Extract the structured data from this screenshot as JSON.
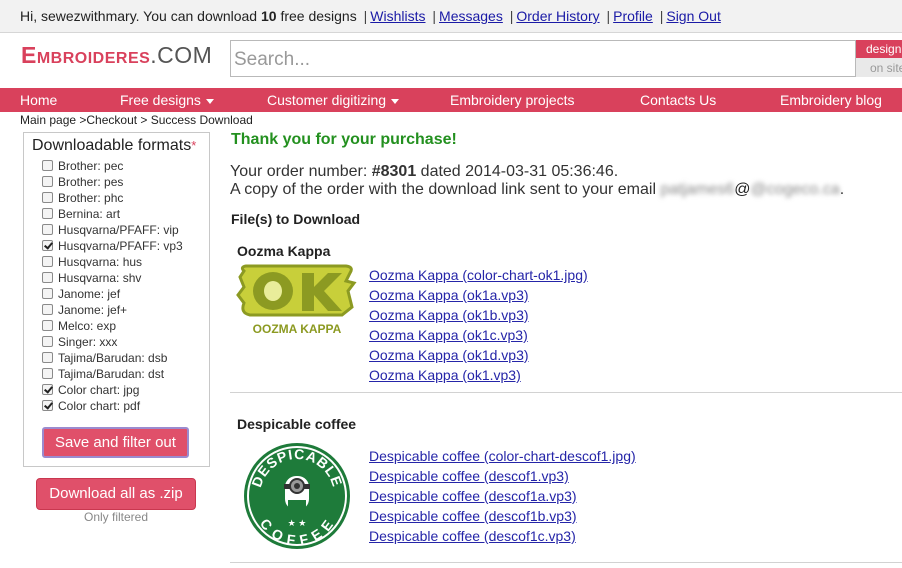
{
  "topbar": {
    "greeting_prefix": "Hi, sewezwithmary. You can download ",
    "free_count": "10",
    "greeting_suffix": " free designs",
    "links": [
      "Wishlists",
      "Messages",
      "Order History",
      "Profile",
      "Sign Out"
    ]
  },
  "header": {
    "logo_main": "Embroideres",
    "logo_suffix": ".COM",
    "search_placeholder": "Search...",
    "search_scope_designs": "design",
    "search_scope_site": "on site"
  },
  "nav": {
    "items": [
      "Home",
      "Free designs",
      "Customer digitizing",
      "Embroidery projects",
      "Contacts Us",
      "Embroidery blog"
    ]
  },
  "breadcrumb": "Main page >Checkout > Success Download",
  "sidebar": {
    "title": "Downloadable formats",
    "required_mark": "*",
    "formats": [
      {
        "label": "Brother: pec",
        "checked": false
      },
      {
        "label": "Brother: pes",
        "checked": false
      },
      {
        "label": "Brother: phc",
        "checked": false
      },
      {
        "label": "Bernina: art",
        "checked": false
      },
      {
        "label": "Husqvarna/PFAFF: vip",
        "checked": false
      },
      {
        "label": "Husqvarna/PFAFF: vp3",
        "checked": true
      },
      {
        "label": "Husqvarna: hus",
        "checked": false
      },
      {
        "label": "Husqvarna: shv",
        "checked": false
      },
      {
        "label": "Janome: jef",
        "checked": false
      },
      {
        "label": "Janome: jef+",
        "checked": false
      },
      {
        "label": "Melco: exp",
        "checked": false
      },
      {
        "label": "Singer: xxx",
        "checked": false
      },
      {
        "label": "Tajima/Barudan: dsb",
        "checked": false
      },
      {
        "label": "Tajima/Barudan: dst",
        "checked": false
      },
      {
        "label": "Color chart: jpg",
        "checked": true
      },
      {
        "label": "Color chart: pdf",
        "checked": true
      }
    ],
    "save_button": "Save and filter out",
    "download_zip_button": "Download all as .zip",
    "only_filtered": "Only filtered"
  },
  "main": {
    "thanks": "Thank you for your purchase!",
    "order_prefix": "Your order number: ",
    "order_number": "#8301",
    "order_suffix": " dated 2014-03-31 05:36:46.",
    "copy_text": "A copy of the order with the download link sent to your email ",
    "email_local": "patjames6",
    "email_domain": "@cogeco.ca",
    "email_end": ".",
    "files_heading": "File(s) to Download",
    "designs": [
      {
        "title": "Oozma Kappa",
        "thumb_text": "OOZMA KAPPA",
        "thumb_letters": "OK",
        "files": [
          "Oozma Kappa (color-chart-ok1.jpg)",
          "Oozma Kappa (ok1a.vp3)",
          "Oozma Kappa (ok1b.vp3)",
          "Oozma Kappa (ok1c.vp3)",
          "Oozma Kappa (ok1d.vp3)",
          "Oozma Kappa (ok1.vp3)"
        ]
      },
      {
        "title": "Despicable coffee",
        "thumb_top": "DESPICABLE",
        "thumb_bottom": "COFFEE",
        "files": [
          "Despicable coffee (color-chart-descof1.jpg)",
          "Despicable coffee (descof1.vp3)",
          "Despicable coffee (descof1a.vp3)",
          "Despicable coffee (descof1b.vp3)",
          "Despicable coffee (descof1c.vp3)"
        ]
      }
    ]
  },
  "colors": {
    "brand": "#d9415c",
    "success": "#23901f",
    "link": "#1a1aa6",
    "ok_green": "#8c9a22",
    "ok_yellow": "#c8cf3a",
    "coffee_green": "#1e7b3a"
  }
}
